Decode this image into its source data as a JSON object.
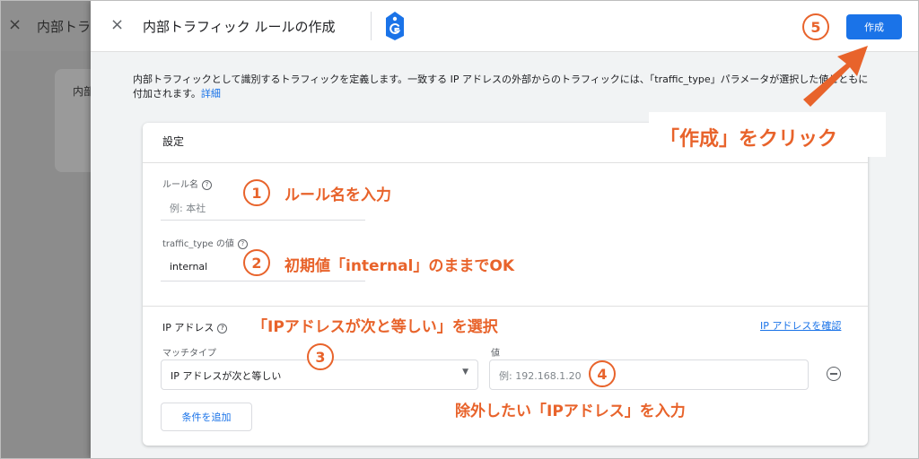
{
  "background": {
    "close_glyph": "×",
    "title": "内部トラ",
    "card_text": "内部"
  },
  "panel": {
    "close_glyph": "×",
    "title": "内部トラフィック ルールの作成",
    "create_button": "作成",
    "description": "内部トラフィックとして識別するトラフィックを定義します。一致する IP アドレスの外部からのトラフィックには、「traffic_type」パラメータが選択した値とともに付加されます。",
    "description_link": "詳細",
    "card_title": "設定",
    "rule_name": {
      "label": "ルール名",
      "placeholder": "例: 本社"
    },
    "traffic_type": {
      "label": "traffic_type の値",
      "value": "internal"
    },
    "ip_section": {
      "label": "IP アドレス",
      "confirm_link": "IP アドレスを確認",
      "match_type_label": "マッチタイプ",
      "match_type_value": "IP アドレスが次と等しい",
      "value_label": "値",
      "value_placeholder": "例: 192.168.1.20",
      "add_condition": "条件を追加"
    }
  },
  "annotations": {
    "n1": "1",
    "n2": "2",
    "n3": "3",
    "n4": "4",
    "n5": "5",
    "a1": "ルール名を入力",
    "a2": "初期値「internal」のままでOK",
    "a_ip": "「IPアドレスが次と等しい」を選択",
    "a4": "除外したい「IPアドレス」を入力",
    "a5": "「作成」をクリック",
    "color": "#e8632b"
  },
  "colors": {
    "accent": "#1a73e8",
    "annotation": "#e8632b"
  }
}
